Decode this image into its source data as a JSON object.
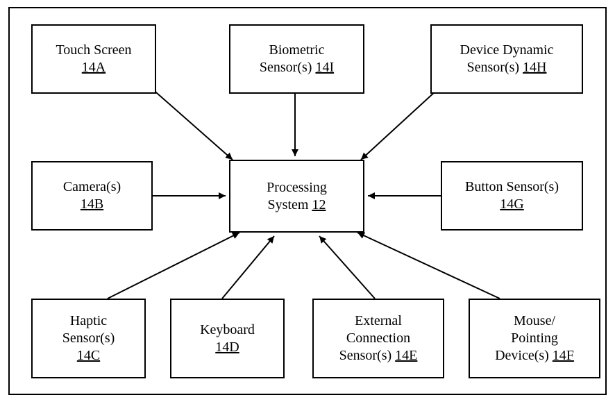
{
  "center": {
    "label": "Processing System",
    "ref": "12"
  },
  "nodes": {
    "touch": {
      "label": "Touch Screen",
      "ref": "14A"
    },
    "bio": {
      "label": "Biometric Sensor(s)",
      "ref": "14I"
    },
    "ddyn": {
      "label": "Device Dynamic Sensor(s)",
      "ref": "14H"
    },
    "camera": {
      "label": "Camera(s)",
      "ref": "14B"
    },
    "button": {
      "label": "Button Sensor(s)",
      "ref": "14G"
    },
    "haptic": {
      "label": "Haptic Sensor(s)",
      "ref": "14C"
    },
    "keyboard": {
      "label": "Keyboard",
      "ref": "14D"
    },
    "ext": {
      "label": "External Connection Sensor(s)",
      "ref": "14E"
    },
    "mouse": {
      "label": "Mouse/ Pointing Device(s)",
      "ref": "14F"
    }
  }
}
